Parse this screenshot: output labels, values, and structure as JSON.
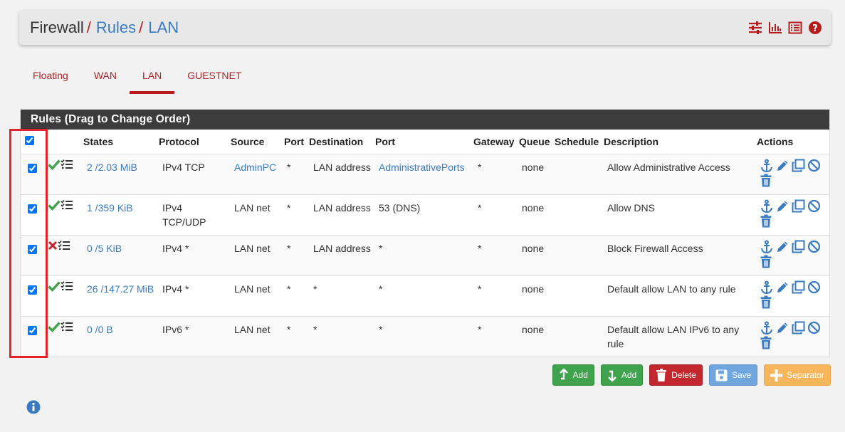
{
  "breadcrumb": {
    "root": "Firewall",
    "sep": "/",
    "rules": "Rules",
    "current": "LAN"
  },
  "header_icons": [
    "sliders-icon",
    "chart-icon",
    "list-icon",
    "help-icon"
  ],
  "tabs": [
    {
      "label": "Floating",
      "active": false
    },
    {
      "label": "WAN",
      "active": false
    },
    {
      "label": "LAN",
      "active": true
    },
    {
      "label": "GUESTNET",
      "active": false
    }
  ],
  "panel": {
    "title": "Rules (Drag to Change Order)"
  },
  "columns": {
    "states": "States",
    "protocol": "Protocol",
    "source": "Source",
    "port": "Port",
    "destination": "Destination",
    "port2": "Port",
    "gateway": "Gateway",
    "queue": "Queue",
    "schedule": "Schedule",
    "description": "Description",
    "actions": "Actions"
  },
  "rules": [
    {
      "checked": true,
      "status": "pass",
      "states": "2 /2.03 MiB",
      "protocol": "IPv4 TCP",
      "source": "AdminPC",
      "source_link": true,
      "src_port": "*",
      "destination": "LAN address",
      "dst_port": "AdministrativePorts",
      "dst_port_link": true,
      "gateway": "*",
      "queue": "none",
      "schedule": "",
      "description": "Allow Administrative Access"
    },
    {
      "checked": true,
      "status": "pass",
      "states": "1 /359 KiB",
      "protocol": "IPv4 TCP/UDP",
      "source": "LAN net",
      "source_link": false,
      "src_port": "*",
      "destination": "LAN address",
      "dst_port": "53 (DNS)",
      "dst_port_link": false,
      "gateway": "*",
      "queue": "none",
      "schedule": "",
      "description": "Allow DNS"
    },
    {
      "checked": true,
      "status": "block",
      "states": "0 /5 KiB",
      "protocol": "IPv4 *",
      "source": "LAN net",
      "source_link": false,
      "src_port": "*",
      "destination": "LAN address",
      "dst_port": "*",
      "dst_port_link": false,
      "gateway": "*",
      "queue": "none",
      "schedule": "",
      "description": "Block Firewall Access"
    },
    {
      "checked": true,
      "status": "pass",
      "states": "26 /147.27 MiB",
      "protocol": "IPv4 *",
      "source": "LAN net",
      "source_link": false,
      "src_port": "*",
      "destination": "*",
      "dst_port": "*",
      "dst_port_link": false,
      "gateway": "*",
      "queue": "none",
      "schedule": "",
      "description": "Default allow LAN to any rule"
    },
    {
      "checked": true,
      "status": "pass",
      "states": "0 /0 B",
      "protocol": "IPv6 *",
      "source": "LAN net",
      "source_link": false,
      "src_port": "*",
      "destination": "*",
      "dst_port": "*",
      "dst_port_link": false,
      "gateway": "*",
      "queue": "none",
      "schedule": "",
      "description": "Default allow LAN IPv6 to any rule"
    }
  ],
  "buttons": {
    "add_top": "Add",
    "add_bottom": "Add",
    "delete": "Delete",
    "save": "Save",
    "separator": "Separator"
  },
  "colors": {
    "accent_red": "#b71c1c",
    "link_blue": "#3a7bc0",
    "pass_green": "#3fa34d",
    "block_red": "#c1272d",
    "highlight_box": "#e3232b"
  }
}
